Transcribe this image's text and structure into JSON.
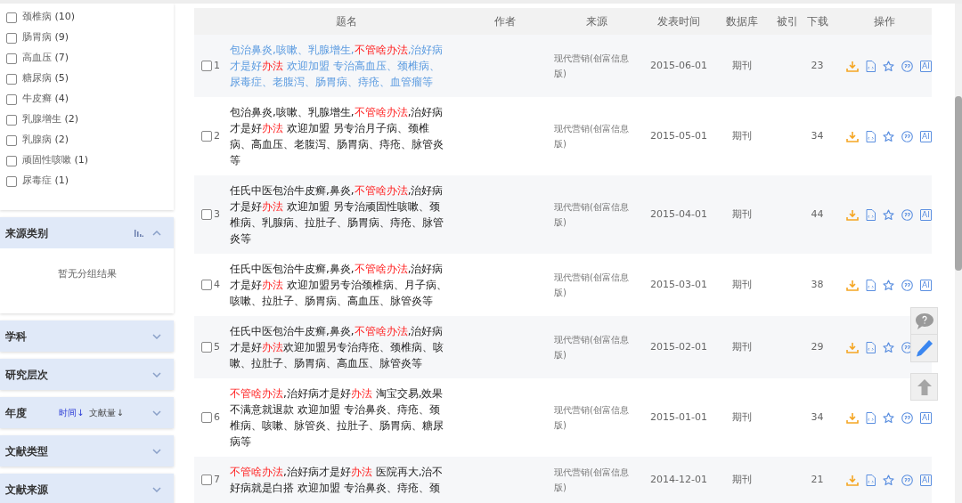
{
  "filters": [
    {
      "name": "颈椎病",
      "count": "(10)",
      "checked": false
    },
    {
      "name": "肠胃病",
      "count": "(9)",
      "checked": false
    },
    {
      "name": "高血压",
      "count": "(7)",
      "checked": false
    },
    {
      "name": "糖尿病",
      "count": "(5)",
      "checked": false
    },
    {
      "name": "牛皮癣",
      "count": "(4)",
      "checked": false
    },
    {
      "name": "乳腺增生",
      "count": "(2)",
      "checked": false
    },
    {
      "name": "乳腺病",
      "count": "(2)",
      "checked": false
    },
    {
      "name": "顽固性咳嗽",
      "count": "(1)",
      "checked": false
    },
    {
      "name": "尿毒症",
      "count": "(1)",
      "checked": false
    }
  ],
  "sections": [
    {
      "title": "来源类别",
      "expanded": true,
      "empty_text": "暂无分组结果"
    },
    {
      "title": "学科",
      "expanded": false
    },
    {
      "title": "研究层次",
      "expanded": false
    },
    {
      "title": "年度",
      "expanded": false,
      "sort_options": [
        {
          "label": "时间↓",
          "selected": true
        },
        {
          "label": "文献量↓",
          "selected": false
        }
      ]
    },
    {
      "title": "文献类型",
      "expanded": false
    },
    {
      "title": "文献来源",
      "expanded": false
    }
  ],
  "table": {
    "columns": [
      "题名",
      "作者",
      "来源",
      "发表时间",
      "数据库",
      "被引",
      "下载",
      "操作"
    ],
    "rows": [
      {
        "number": "1",
        "checked": false,
        "visited": true,
        "title": [
          {
            "text": "包治鼻炎,咳嗽、乳腺增生,"
          },
          {
            "text": "不管啥办法",
            "hit": true
          },
          {
            "text": ",治好病才是好"
          },
          {
            "text": "办法",
            "hit": true
          },
          {
            "text": " 欢迎加盟 专治高血压、颈椎病、尿毒症、老腹泻、肠胃病、痔疮、血管瘤等"
          }
        ],
        "source": "现代营销(创富信息版)",
        "date": "2015-06-01",
        "database": "期刊",
        "downloads": "23",
        "ai": "AI"
      },
      {
        "number": "2",
        "checked": false,
        "visited": false,
        "title": [
          {
            "text": "包治鼻炎,咳嗽、乳腺增生,"
          },
          {
            "text": "不管啥办法",
            "hit": true
          },
          {
            "text": ",治好病才是好"
          },
          {
            "text": "办法",
            "hit": true
          },
          {
            "text": " 欢迎加盟 另专治月子病、颈椎病、高血压、老腹泻、肠胃病、痔疮、脉管炎等"
          }
        ],
        "source": "现代营销(创富信息版)",
        "date": "2015-05-01",
        "database": "期刊",
        "downloads": "34",
        "ai": "AI"
      },
      {
        "number": "3",
        "checked": false,
        "visited": false,
        "title": [
          {
            "text": "任氏中医包治牛皮癣,鼻炎,"
          },
          {
            "text": "不管啥办法",
            "hit": true
          },
          {
            "text": ",治好病才是好"
          },
          {
            "text": "办法",
            "hit": true
          },
          {
            "text": " 欢迎加盟 另专治顽固性咳嗽、颈椎病、乳腺病、拉肚子、肠胃病、痔疮、脉管炎等"
          }
        ],
        "source": "现代营销(创富信息版)",
        "date": "2015-04-01",
        "database": "期刊",
        "downloads": "44",
        "ai": "AI"
      },
      {
        "number": "4",
        "checked": false,
        "visited": false,
        "title": [
          {
            "text": "任氏中医包治牛皮癣,鼻炎,"
          },
          {
            "text": "不管啥办法",
            "hit": true
          },
          {
            "text": ",治好病才是好"
          },
          {
            "text": "办法",
            "hit": true
          },
          {
            "text": " 欢迎加盟另专治颈椎病、月子病、咳嗽、拉肚子、肠胃病、高血压、脉管炎等"
          }
        ],
        "source": "现代营销(创富信息版)",
        "date": "2015-03-01",
        "database": "期刊",
        "downloads": "38",
        "ai": "AI"
      },
      {
        "number": "5",
        "checked": false,
        "visited": false,
        "title": [
          {
            "text": "任氏中医包治牛皮癣,鼻炎,"
          },
          {
            "text": "不管啥办法",
            "hit": true
          },
          {
            "text": ",治好病才是好"
          },
          {
            "text": "办法",
            "hit": true
          },
          {
            "text": "欢迎加盟另专治痔疮、颈椎病、咳嗽、拉肚子、肠胃病、高血压、脉管炎等"
          }
        ],
        "source": "现代营销(创富信息版)",
        "date": "2015-02-01",
        "database": "期刊",
        "downloads": "29"
      },
      {
        "number": "6",
        "checked": false,
        "visited": false,
        "title": [
          {
            "text": "不管啥办法",
            "hit": true
          },
          {
            "text": ",治好病才是好"
          },
          {
            "text": "办法",
            "hit": true
          },
          {
            "text": " 淘宝交易,效果不满意就退款 欢迎加盟 专治鼻炎、痔疮、颈椎病、咳嗽、脉管炎、拉肚子、肠胃病、糖尿病等"
          }
        ],
        "source": "现代营销(创富信息版)",
        "date": "2015-01-01",
        "database": "期刊",
        "downloads": "34",
        "ai": "AI"
      },
      {
        "number": "7",
        "checked": false,
        "visited": false,
        "title": [
          {
            "text": "不管啥办法",
            "hit": true
          },
          {
            "text": ",治好病才是好"
          },
          {
            "text": "办法",
            "hit": true
          },
          {
            "text": " 医院再大,治不好病就是白搭 欢迎加盟 专治鼻炎、痔疮、颈"
          }
        ],
        "source": "现代营销(创富信息版)",
        "date": "2014-12-01",
        "database": "期刊",
        "downloads": "21",
        "ai": "AI"
      }
    ]
  }
}
